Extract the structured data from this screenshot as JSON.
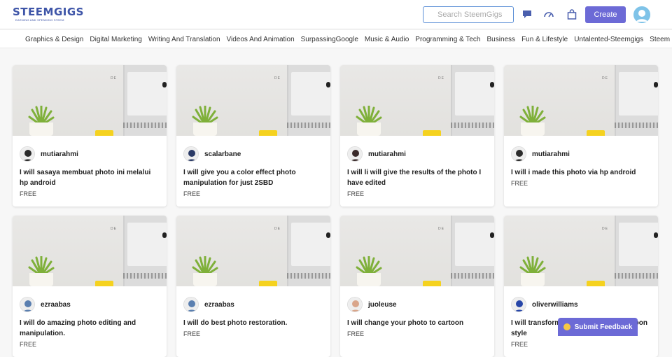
{
  "header": {
    "logo_text": "STEEMGIGS",
    "logo_tagline": "EARNING AND SPENDING STEEM",
    "search_placeholder": "Search SteemGigs",
    "create_label": "Create"
  },
  "categories": [
    "Graphics & Design",
    "Digital Marketing",
    "Writing And Translation",
    "Videos And Animation",
    "SurpassingGoogle",
    "Music & Audio",
    "Programming & Tech",
    "Business",
    "Fun & Lifestyle",
    "Untalented-Steemgigs",
    "Steem & Steemit"
  ],
  "gigs": [
    {
      "seller": "mutiarahmi",
      "title": "I will sasaya membuat photo ini melalui hp android",
      "price": "FREE"
    },
    {
      "seller": "scalarbane",
      "title": "I will give you a color effect photo manipulation for just 2SBD",
      "price": "FREE"
    },
    {
      "seller": "mutiarahmi",
      "title": "I will li will give the results of the photo I have edited",
      "price": "FREE"
    },
    {
      "seller": "mutiarahmi",
      "title": "I will i made this photo via hp android",
      "price": "FREE"
    },
    {
      "seller": "ezraabas",
      "title": "I will do amazing photo editing and manipulation.",
      "price": "FREE"
    },
    {
      "seller": "ezraabas",
      "title": "I will do best photo restoration.",
      "price": "FREE"
    },
    {
      "seller": "juoleuse",
      "title": "I will change your photo to cartoon",
      "price": "FREE"
    },
    {
      "seller": "oliverwilliams",
      "title": "I will transform your photo into a cartoon style",
      "price": "FREE"
    }
  ],
  "thumb_text": {
    "brand": "DE",
    "top": "PIXEL"
  },
  "feedback_label": "Submit Feedback",
  "colors": {
    "brand": "#3e55a8",
    "accent": "#6c6ad6",
    "search_border": "#5b8fd6"
  }
}
